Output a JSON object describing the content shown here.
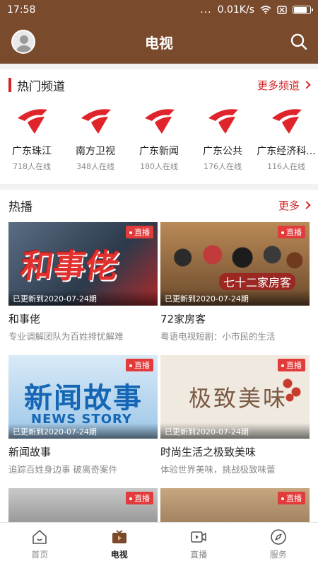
{
  "status": {
    "time": "17:58",
    "signal_dots": "...",
    "net_speed": "0.01K/s",
    "battery_level": 0.85
  },
  "header": {
    "title": "电视"
  },
  "hot_channels": {
    "title": "热门频道",
    "more_label": "更多频道",
    "items": [
      {
        "name": "广东珠江",
        "online": "718人在线"
      },
      {
        "name": "南方卫视",
        "online": "348人在线"
      },
      {
        "name": "广东新闻",
        "online": "180人在线"
      },
      {
        "name": "广东公共",
        "online": "176人在线"
      },
      {
        "name": "广东经济科...",
        "online": "116人在线"
      }
    ]
  },
  "hot_broadcast": {
    "title": "热播",
    "more_label": "更多",
    "items": [
      {
        "title": "和事佬",
        "desc": "专业调解团队为百姓排忧解难",
        "live": "直播",
        "updated": "已更新到2020-07-24期",
        "art_text": "和事佬"
      },
      {
        "title": "72家房客",
        "desc": "粤语电视短剧：小市民的生活",
        "live": "直播",
        "updated": "已更新到2020-07-24期",
        "art_text": "七十二家房客"
      },
      {
        "title": "新闻故事",
        "desc": "追踪百姓身边事 破离奇案件",
        "live": "直播",
        "updated": "已更新到2020-07-24期",
        "art_text": "新闻故事",
        "art_text_en": "NEWS STORY"
      },
      {
        "title": "时尚生活之极致美味",
        "desc": "体验世界美味，挑战极致味蕾",
        "live": "直播",
        "updated": "已更新到2020-07-24期",
        "art_text": "极致美味"
      },
      {
        "title": "",
        "desc": "",
        "live": "直播",
        "updated": ""
      },
      {
        "title": "",
        "desc": "",
        "live": "直播",
        "updated": ""
      }
    ]
  },
  "bottom_nav": [
    {
      "label": "首页",
      "icon": "home-icon"
    },
    {
      "label": "电视",
      "icon": "tv-icon",
      "active": true
    },
    {
      "label": "直播",
      "icon": "video-icon"
    },
    {
      "label": "服务",
      "icon": "compass-icon"
    }
  ],
  "colors": {
    "brand": "#7a4a2d",
    "accent": "#d22727",
    "live_badge": "#e23b3b"
  }
}
